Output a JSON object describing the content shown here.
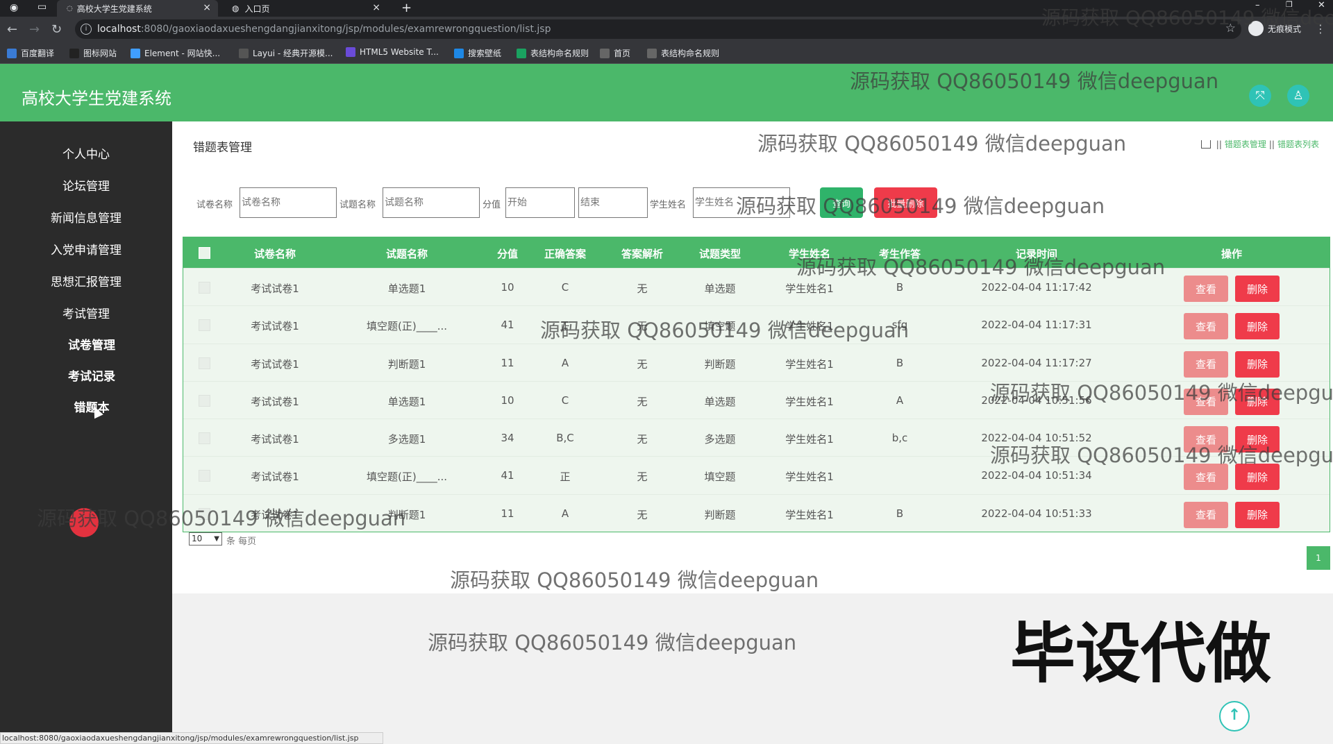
{
  "browser": {
    "tabs": [
      {
        "title": "高校大学生党建系统",
        "close": "×"
      },
      {
        "title": "入口页",
        "close": "×"
      }
    ],
    "new_tab": "+",
    "window_controls": [
      "–",
      "❐",
      "✕"
    ],
    "url_host": "localhost",
    "url_path": ":8080/gaoxiaodaxueshengdangjianxitong/jsp/modules/examrewrongquestion/list.jsp",
    "profile_label": "无痕模式",
    "bookmarks": [
      {
        "label": "百度翻译",
        "icon": "translate-icon",
        "color": "#3a7bd5"
      },
      {
        "label": "图标网站",
        "icon": "flag-icon",
        "color": "#222"
      },
      {
        "label": "Element - 网站快...",
        "icon": "element-icon",
        "color": "#409eff"
      },
      {
        "label": "Layui - 经典开源模...",
        "icon": "layui-icon",
        "color": "#555"
      },
      {
        "label": "HTML5 Website T...",
        "icon": "html5-icon",
        "color": "#6a4bd8"
      },
      {
        "label": "搜索壁纸",
        "icon": "search-wallpaper-icon",
        "color": "#1e88e5"
      },
      {
        "label": "表结构命名规则",
        "icon": "doc-icon",
        "color": "#1aa260"
      },
      {
        "label": "首页",
        "icon": "globe-icon",
        "color": "#666"
      },
      {
        "label": "表结构命名规则",
        "icon": "globe-icon",
        "color": "#666"
      }
    ],
    "status_url": "localhost:8080/gaoxiaodaxueshengdangjianxitong/jsp/modules/examrewrongquestion/list.jsp"
  },
  "app": {
    "title": "高校大学生党建系统",
    "accent": "#4bb86a",
    "header_icons": [
      "fullscreen-icon",
      "user-icon"
    ]
  },
  "sidebar": {
    "items": [
      {
        "label": "个人中心"
      },
      {
        "label": "论坛管理"
      },
      {
        "label": "新闻信息管理"
      },
      {
        "label": "入党申请管理"
      },
      {
        "label": "思想汇报管理"
      },
      {
        "label": "考试管理"
      },
      {
        "label": "试卷管理"
      },
      {
        "label": "考试记录"
      },
      {
        "label": "错题本"
      }
    ],
    "active": "错题本"
  },
  "page": {
    "title": "错题表管理",
    "breadcrumb": [
      "错题表管理",
      "错题表列表"
    ]
  },
  "search": {
    "paper_label": "试卷名称",
    "paper_placeholder": "试卷名称",
    "question_label": "试题名称",
    "question_placeholder": "试题名称",
    "score_label": "分值",
    "score_start_placeholder": "开始",
    "score_end_placeholder": "结束",
    "student_label": "学生姓名",
    "student_placeholder": "学生姓名",
    "search_button": "查询",
    "batch_delete_button": "批量删除"
  },
  "table": {
    "headers": [
      "试卷名称",
      "试题名称",
      "分值",
      "正确答案",
      "答案解析",
      "试题类型",
      "学生姓名",
      "考生作答",
      "记录时间",
      "操作"
    ],
    "view_label": "查看",
    "delete_label": "删除",
    "rows": [
      {
        "paper": "考试试卷1",
        "question": "单选题1",
        "score": "10",
        "answer": "C",
        "analysis": "无",
        "type": "单选题",
        "student": "学生姓名1",
        "response": "B",
        "time": "2022-04-04 11:17:42"
      },
      {
        "paper": "考试试卷1",
        "question": "填空题(正)____...",
        "score": "41",
        "answer": "正",
        "analysis": "无",
        "type": "填空题",
        "student": "学生姓名1",
        "response": "sfg",
        "time": "2022-04-04 11:17:31"
      },
      {
        "paper": "考试试卷1",
        "question": "判断题1",
        "score": "11",
        "answer": "A",
        "analysis": "无",
        "type": "判断题",
        "student": "学生姓名1",
        "response": "B",
        "time": "2022-04-04 11:17:27"
      },
      {
        "paper": "考试试卷1",
        "question": "单选题1",
        "score": "10",
        "answer": "C",
        "analysis": "无",
        "type": "单选题",
        "student": "学生姓名1",
        "response": "A",
        "time": "2022-04-04 10:51:56"
      },
      {
        "paper": "考试试卷1",
        "question": "多选题1",
        "score": "34",
        "answer": "B,C",
        "analysis": "无",
        "type": "多选题",
        "student": "学生姓名1",
        "response": "b,c",
        "time": "2022-04-04 10:51:52"
      },
      {
        "paper": "考试试卷1",
        "question": "填空题(正)____...",
        "score": "41",
        "answer": "正",
        "analysis": "无",
        "type": "填空题",
        "student": "学生姓名1",
        "response": "",
        "time": "2022-04-04 10:51:34"
      },
      {
        "paper": "考试试卷1",
        "question": "判断题1",
        "score": "11",
        "answer": "A",
        "analysis": "无",
        "type": "判断题",
        "student": "学生姓名1",
        "response": "B",
        "time": "2022-04-04 10:51:33"
      }
    ]
  },
  "pagination": {
    "page_size": "10",
    "per_page_label": "条 每页",
    "current_page": "1"
  },
  "watermark": {
    "text": "源码获取 QQ86050149 微信deepguan",
    "big_text": "毕设代做"
  }
}
